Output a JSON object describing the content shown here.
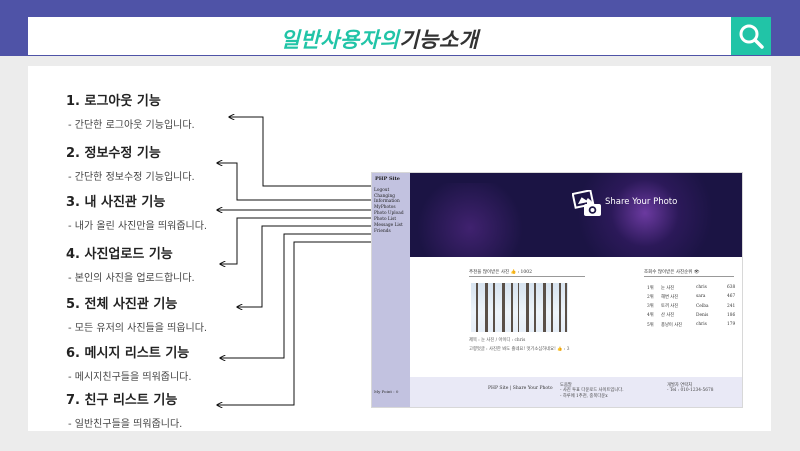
{
  "header": {
    "title_highlight": "일반사용자의",
    "title_rest": "기능소개",
    "search_icon": "search-icon",
    "accent_color": "#21c4a7",
    "bar_color": "#4f53a7"
  },
  "features": [
    {
      "title": "1. 로그아웃 기능",
      "desc": "-  간단한 로그아웃 기능입니다."
    },
    {
      "title": "2. 정보수정 기능",
      "desc": "-  간단한 정보수정 기능입니다."
    },
    {
      "title": "3. 내 사진관 기능",
      "desc": "-  내가 올린 사진만을 띄워줍니다."
    },
    {
      "title": "4. 사진업로드 기능",
      "desc": "-  본인의 사진을 업로드합니다."
    },
    {
      "title": "5. 전체 사진관 기능",
      "desc": "-  모든 유저의 사진들을 띄웁니다."
    },
    {
      "title": "6. 메시지 리스트 기능",
      "desc": "-  메시지친구들을 띄워줍니다."
    },
    {
      "title": "7. 친구 리스트 기능",
      "desc": "-  일반친구들을 띄워줍니다."
    }
  ],
  "mock": {
    "brand": "PHP Site",
    "menu": [
      "Logout",
      "Changing Information",
      "MyPhotos",
      "Photo Upload",
      "Photo List",
      "Message List",
      "Friends"
    ],
    "points": "My Point : 0",
    "hero_text": "Share Your Photo",
    "recommend_title": "추천을 많이받은 사진",
    "recommend_count": "👍 : 1002",
    "caption1": "제목 : 눈 사진 / 아이디 : chris",
    "caption2": "고향멋글 : 사진한 봐도 즐네요! 멋기소심하네요! 👍 : 3",
    "ranking_title": "조회수 많이받은 사진순위 👁",
    "ranking": [
      {
        "rank": "1위",
        "name": "눈 사진",
        "user": "chris",
        "views": "638"
      },
      {
        "rank": "2위",
        "name": "해변 사진",
        "user": "sara",
        "views": "467"
      },
      {
        "rank": "3위",
        "name": "토끼 사진",
        "user": "Celba",
        "views": "241"
      },
      {
        "rank": "4위",
        "name": "산 사진",
        "user": "Denis",
        "views": "186"
      },
      {
        "rank": "5위",
        "name": "풍냥이 사진",
        "user": "chris",
        "views": "179"
      }
    ],
    "footer_brand": "PHP Site | Share Your Photo",
    "footer_help_title": "도움말",
    "footer_help_1": "- 사진 투표 다운로드 사이트입니다.",
    "footer_help_2": "- 하루에 1추천, 중복다운x",
    "footer_contact_title": "개발자 연락처",
    "footer_contact": "- Tel : 010-1234-5678"
  }
}
